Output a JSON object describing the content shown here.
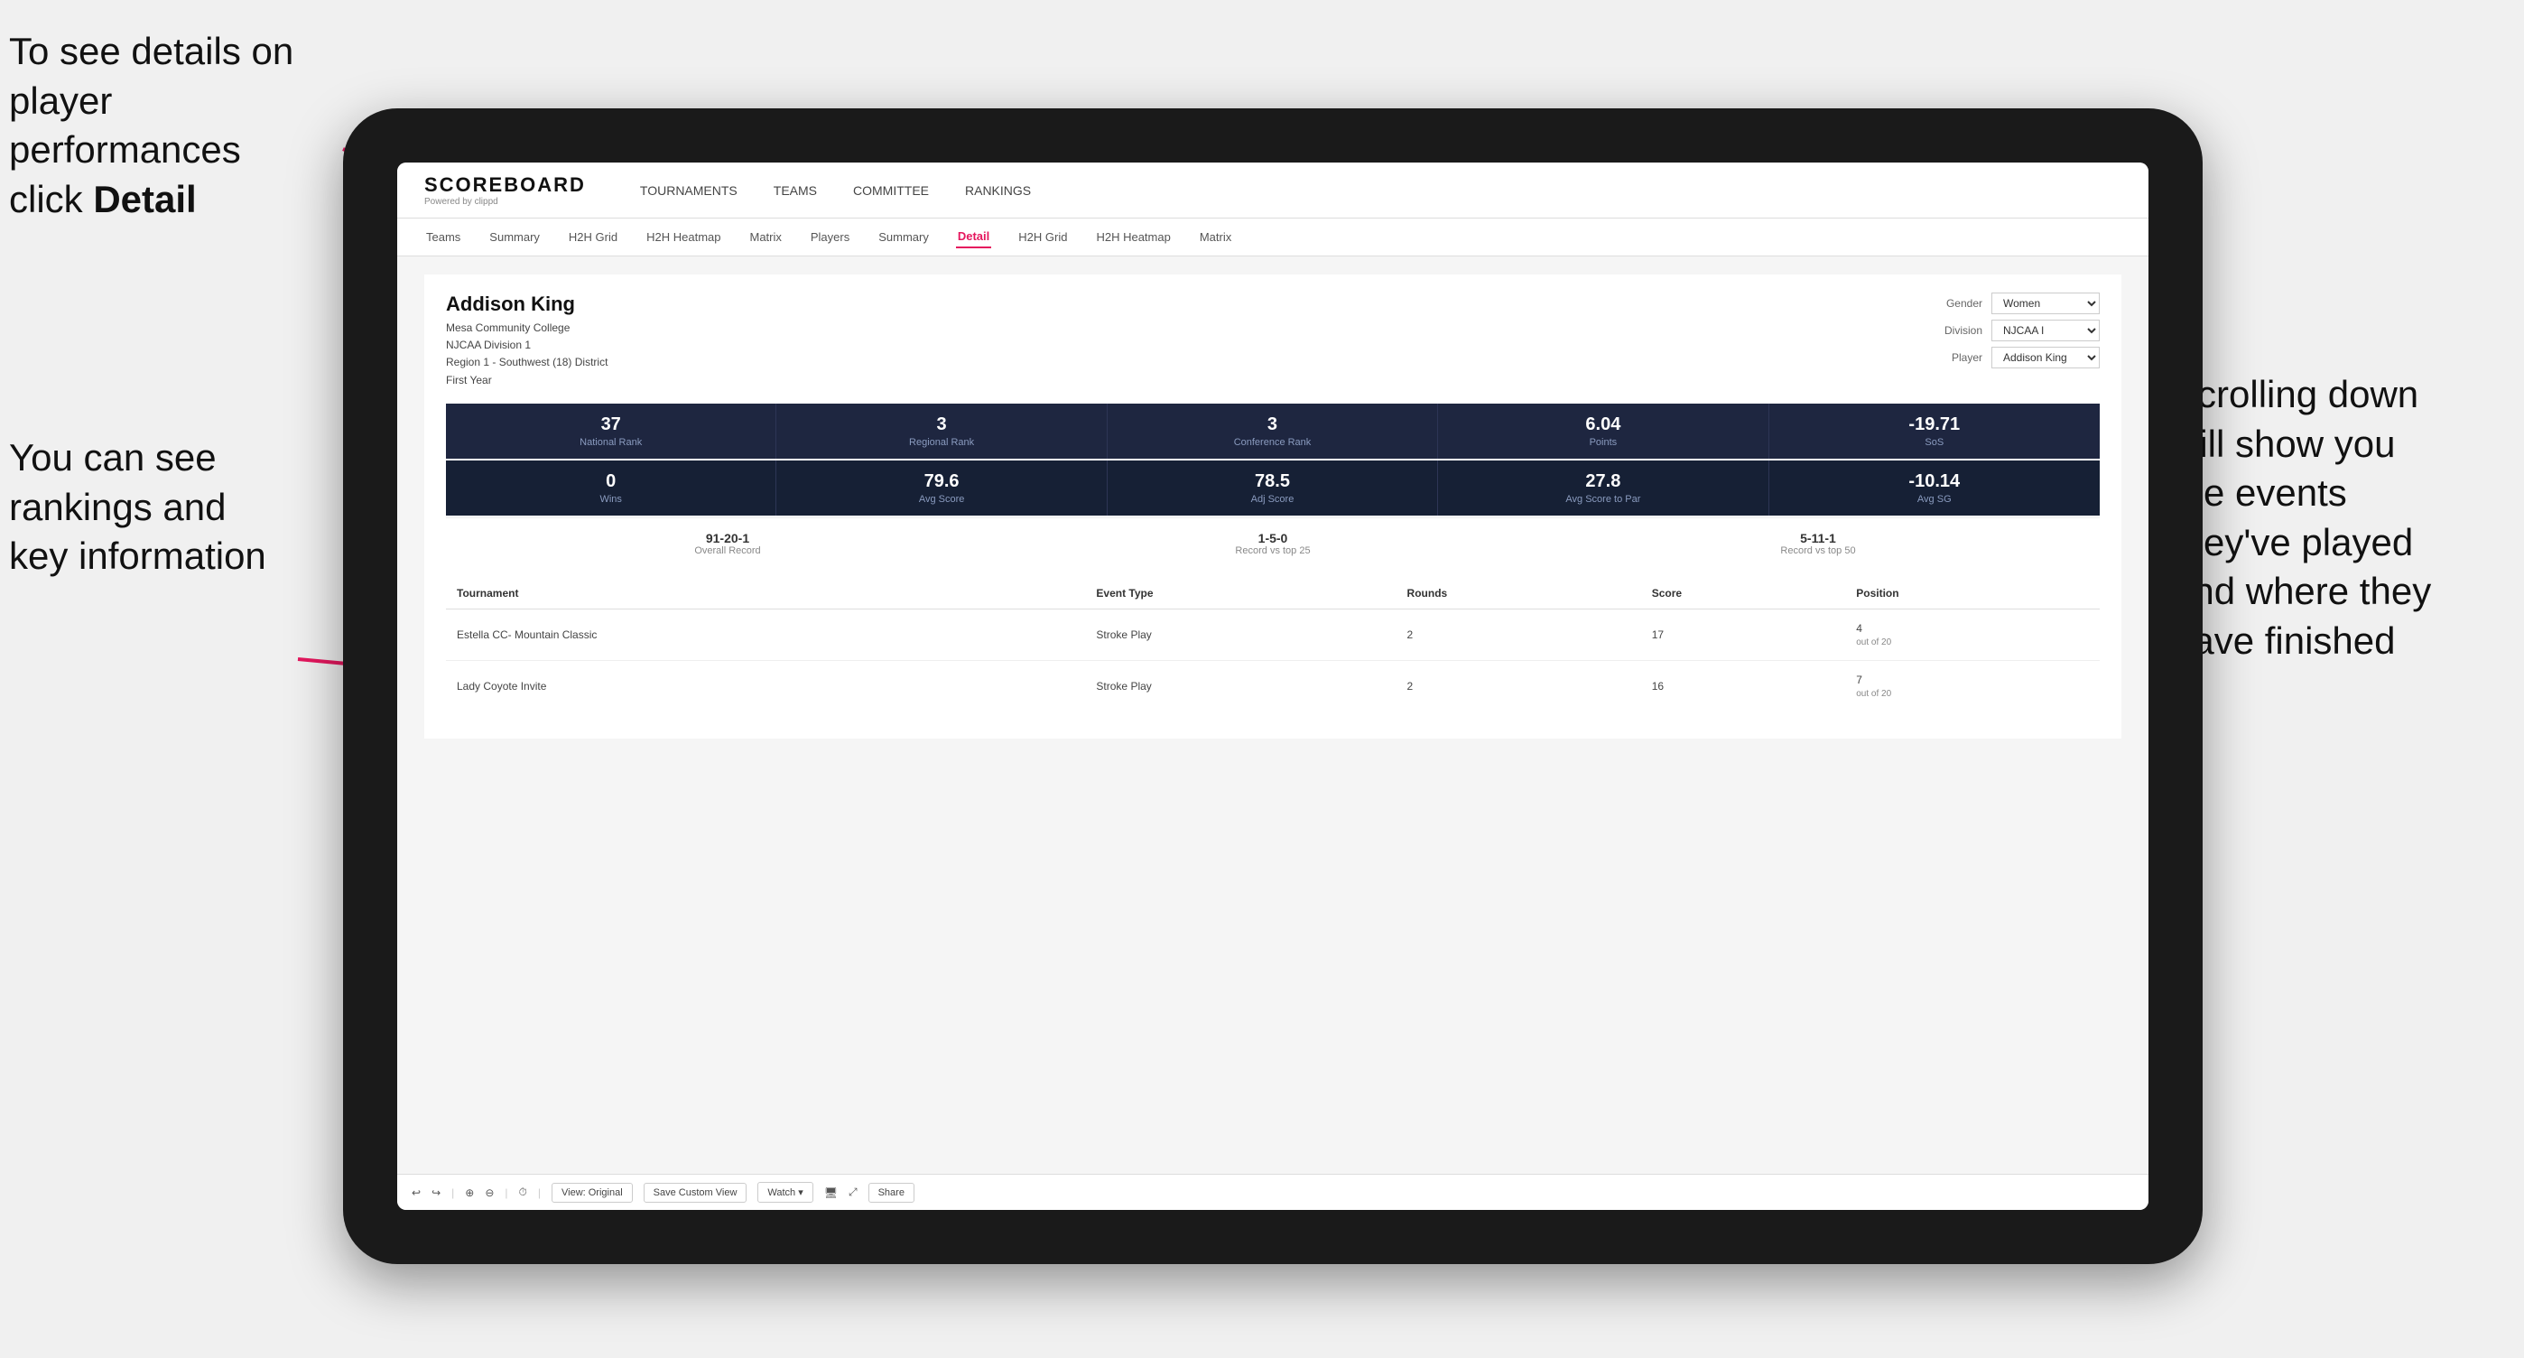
{
  "annotations": {
    "top_left": {
      "line1": "To see details on",
      "line2": "player performances",
      "line3_prefix": "click ",
      "line3_bold": "Detail"
    },
    "bottom_left": {
      "line1": "You can see",
      "line2": "rankings and",
      "line3": "key information"
    },
    "right": {
      "line1": "Scrolling down",
      "line2": "will show you",
      "line3": "the events",
      "line4": "they've played",
      "line5": "and where they",
      "line6": "have finished"
    }
  },
  "nav": {
    "logo_main": "SCOREBOARD",
    "logo_sub": "Powered by clippd",
    "items": [
      "TOURNAMENTS",
      "TEAMS",
      "COMMITTEE",
      "RANKINGS"
    ]
  },
  "sub_nav": {
    "items": [
      "Teams",
      "Summary",
      "H2H Grid",
      "H2H Heatmap",
      "Matrix",
      "Players",
      "Summary",
      "Detail",
      "H2H Grid",
      "H2H Heatmap",
      "Matrix"
    ],
    "active": "Detail"
  },
  "player": {
    "name": "Addison King",
    "college": "Mesa Community College",
    "division": "NJCAA Division 1",
    "region": "Region 1 - Southwest (18) District",
    "year": "First Year"
  },
  "filters": {
    "gender_label": "Gender",
    "gender_value": "Women",
    "division_label": "Division",
    "division_value": "NJCAA I",
    "player_label": "Player",
    "player_value": "Addison King"
  },
  "stats_row1": [
    {
      "value": "37",
      "label": "National Rank"
    },
    {
      "value": "3",
      "label": "Regional Rank"
    },
    {
      "value": "3",
      "label": "Conference Rank"
    },
    {
      "value": "6.04",
      "label": "Points"
    },
    {
      "value": "-19.71",
      "label": "SoS"
    }
  ],
  "stats_row2": [
    {
      "value": "0",
      "label": "Wins"
    },
    {
      "value": "79.6",
      "label": "Avg Score"
    },
    {
      "value": "78.5",
      "label": "Adj Score"
    },
    {
      "value": "27.8",
      "label": "Avg Score to Par"
    },
    {
      "value": "-10.14",
      "label": "Avg SG"
    }
  ],
  "records": [
    {
      "value": "91-20-1",
      "label": "Overall Record"
    },
    {
      "value": "1-5-0",
      "label": "Record vs top 25"
    },
    {
      "value": "5-11-1",
      "label": "Record vs top 50"
    }
  ],
  "tournament_table": {
    "headers": [
      "Tournament",
      "Event Type",
      "Rounds",
      "Score",
      "Position"
    ],
    "rows": [
      {
        "tournament": "Estella CC- Mountain Classic",
        "event_type": "Stroke Play",
        "rounds": "2",
        "score": "17",
        "position": "4",
        "position_sub": "out of 20"
      },
      {
        "tournament": "Lady Coyote Invite",
        "event_type": "Stroke Play",
        "rounds": "2",
        "score": "16",
        "position": "7",
        "position_sub": "out of 20"
      }
    ]
  },
  "toolbar": {
    "buttons": [
      "View: Original",
      "Save Custom View",
      "Watch ▾",
      "Share"
    ]
  }
}
